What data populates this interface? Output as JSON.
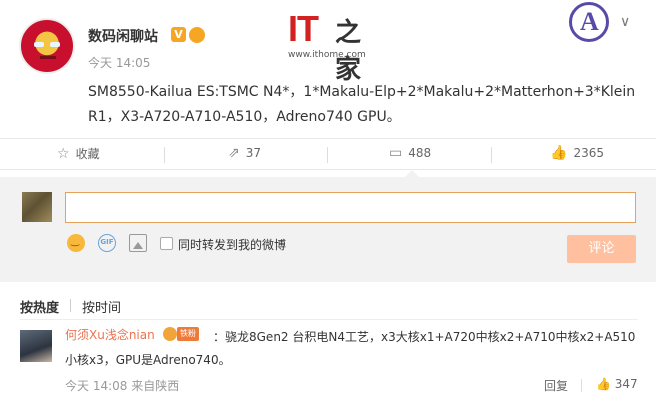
{
  "post": {
    "author": "数码闲聊站",
    "time": "今天 14:05",
    "content": "SM8550-Kailua ES:TSMC N4*，1*Makalu-Elp+2*Makalu+2*Matterhon+3*Klein R1，X3-A720-A710-A510，Adreno740 GPU。"
  },
  "watermark": {
    "brand": "IT",
    "brand_zh": "之家",
    "url": "www.ithome.com"
  },
  "actions": {
    "favorite": "收藏",
    "repost_count": "37",
    "comment_count": "488",
    "like_count": "2365"
  },
  "composer": {
    "forward_label": "同时转发到我的微博",
    "submit_label": "评论",
    "gif_label": "GIF"
  },
  "sort": {
    "hot": "按热度",
    "time": "按时间"
  },
  "comments": [
    {
      "name": "何须Xu浅念nian",
      "badge": "铁粉",
      "text": "：骁龙8Gen2 台积电N4工艺，x3大核x1+A720中核x2+A710中核x2+A510小核x3，GPU是Adreno740。",
      "time": "今天 14:08 来自陕西",
      "reply_label": "回复",
      "likes": "347"
    }
  ],
  "colors": {
    "accent": "#eb7350",
    "submit_bg": "#ffc09f",
    "brand_red": "#d22222"
  }
}
